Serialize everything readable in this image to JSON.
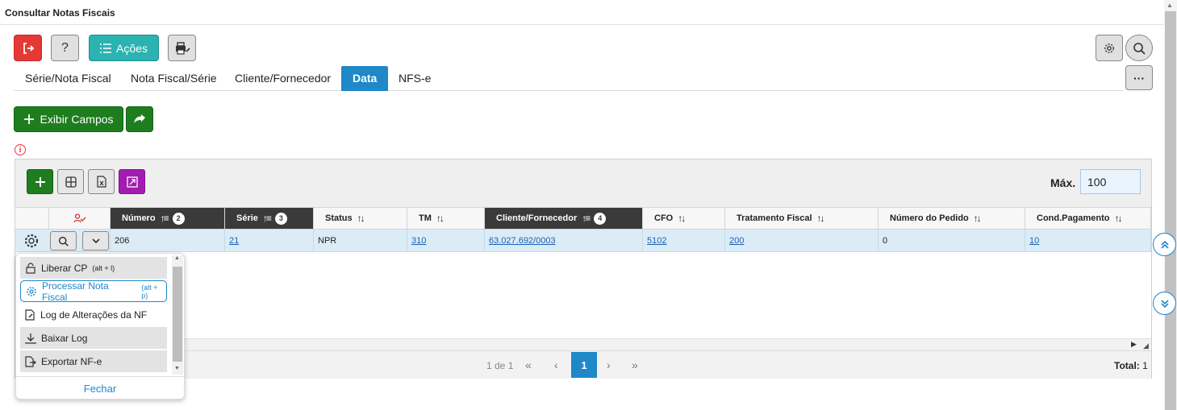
{
  "window": {
    "title": "Consultar Notas Fiscais"
  },
  "toolbar": {
    "acoes_label": "Ações",
    "help_label": "?"
  },
  "tabs": [
    {
      "label": "Série/Nota Fiscal",
      "active": false
    },
    {
      "label": "Nota Fiscal/Série",
      "active": false
    },
    {
      "label": "Cliente/Fornecedor",
      "active": false
    },
    {
      "label": "Data",
      "active": true
    },
    {
      "label": "NFS-e",
      "active": false
    }
  ],
  "actions": {
    "exibir_campos_label": "Exibir Campos"
  },
  "grid": {
    "max_label": "Máx.",
    "max_value": "100",
    "columns": [
      {
        "label": "Número",
        "sort_order": "2",
        "sorted": true
      },
      {
        "label": "Série",
        "sort_order": "3",
        "sorted": true
      },
      {
        "label": "Status",
        "sort_order": "",
        "sorted": false
      },
      {
        "label": "TM",
        "sort_order": "",
        "sorted": false
      },
      {
        "label": "Cliente/Fornecedor",
        "sort_order": "4",
        "sorted": true
      },
      {
        "label": "CFO",
        "sort_order": "",
        "sorted": false
      },
      {
        "label": "Tratamento Fiscal",
        "sort_order": "",
        "sorted": false
      },
      {
        "label": "Número do Pedido",
        "sort_order": "",
        "sorted": false
      },
      {
        "label": "Cond.Pagamento",
        "sort_order": "",
        "sorted": false
      }
    ],
    "rows": [
      {
        "numero": "206",
        "serie": "21",
        "status": "NPR",
        "tm": "310",
        "cliente": "63.027.692/0003",
        "cfo": "5102",
        "tratamento": "200",
        "pedido": "0",
        "cond_pagamento": "10"
      }
    ],
    "pagination": {
      "info": "1 de 1",
      "current": "1",
      "total_label": "Total:",
      "total_value": "1"
    }
  },
  "context_menu": {
    "items": [
      {
        "label": "Liberar CP",
        "shortcut": "(alt + l)",
        "icon": "unlock-icon"
      },
      {
        "label": "Processar Nota Fiscal",
        "shortcut": "(alt + p)",
        "icon": "gear-icon"
      },
      {
        "label": "Log de Alterações da NF",
        "shortcut": "",
        "icon": "edit-file-icon"
      },
      {
        "label": "Baixar Log",
        "shortcut": "",
        "icon": "download-icon"
      },
      {
        "label": "Exportar NF-e",
        "shortcut": "",
        "icon": "export-file-icon"
      }
    ],
    "close_label": "Fechar"
  },
  "colors": {
    "accent_blue": "#1e88c9",
    "teal": "#2ab3b1",
    "green": "#1e7d1e",
    "red": "#e53935",
    "purple": "#a21caf",
    "row_selected": "#dcecf6"
  }
}
